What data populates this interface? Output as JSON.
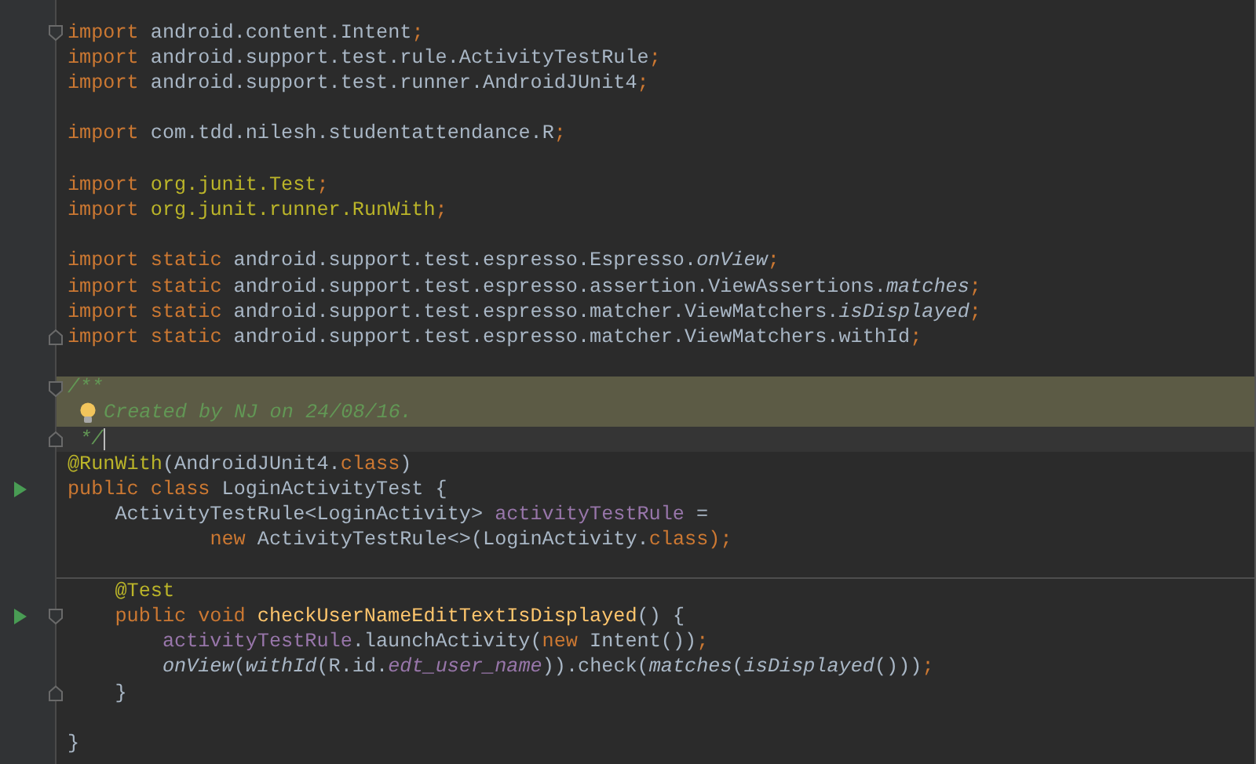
{
  "editor": {
    "lines": [
      {
        "kind": "code",
        "fold_start": true,
        "tokens": [
          {
            "t": "import",
            "kind": "kw"
          },
          {
            "t": " android.content.Intent",
            "kind": "plain"
          },
          {
            "t": ";",
            "kind": "punct"
          }
        ]
      },
      {
        "kind": "code",
        "tokens": [
          {
            "t": "import",
            "kind": "kw"
          },
          {
            "t": " android.support.test.rule.ActivityTestRule",
            "kind": "plain"
          },
          {
            "t": ";",
            "kind": "punct"
          }
        ]
      },
      {
        "kind": "code",
        "tokens": [
          {
            "t": "import",
            "kind": "kw"
          },
          {
            "t": " android.support.test.runner.AndroidJUnit4",
            "kind": "plain"
          },
          {
            "t": ";",
            "kind": "punct"
          }
        ]
      },
      {
        "kind": "blank"
      },
      {
        "kind": "code",
        "tokens": [
          {
            "t": "import",
            "kind": "kw"
          },
          {
            "t": " com.tdd.nilesh.studentattendance.R",
            "kind": "plain"
          },
          {
            "t": ";",
            "kind": "punct"
          }
        ]
      },
      {
        "kind": "blank"
      },
      {
        "kind": "code",
        "tokens": [
          {
            "t": "import",
            "kind": "kw"
          },
          {
            "t": " org.junit.Test",
            "kind": "ann"
          },
          {
            "t": ";",
            "kind": "punct"
          }
        ]
      },
      {
        "kind": "code",
        "tokens": [
          {
            "t": "import",
            "kind": "kw"
          },
          {
            "t": " org.junit.runner.RunWith",
            "kind": "ann"
          },
          {
            "t": ";",
            "kind": "punct"
          }
        ]
      },
      {
        "kind": "blank"
      },
      {
        "kind": "code",
        "tokens": [
          {
            "t": "import static",
            "kind": "kw"
          },
          {
            "t": " android.support.test.espresso.Espresso.",
            "kind": "plain"
          },
          {
            "t": "onView",
            "kind": "italic"
          },
          {
            "t": ";",
            "kind": "punct"
          }
        ]
      },
      {
        "kind": "code",
        "tokens": [
          {
            "t": "import static",
            "kind": "kw"
          },
          {
            "t": " android.support.test.espresso.assertion.ViewAssertions.",
            "kind": "plain"
          },
          {
            "t": "matches",
            "kind": "italic"
          },
          {
            "t": ";",
            "kind": "punct"
          }
        ]
      },
      {
        "kind": "code",
        "tokens": [
          {
            "t": "import static",
            "kind": "kw"
          },
          {
            "t": " android.support.test.espresso.matcher.ViewMatchers.",
            "kind": "plain"
          },
          {
            "t": "isDisplayed",
            "kind": "italic"
          },
          {
            "t": ";",
            "kind": "punct"
          }
        ]
      },
      {
        "kind": "code",
        "fold_end": true,
        "tokens": [
          {
            "t": "import static",
            "kind": "kw"
          },
          {
            "t": " android.support.test.espresso.matcher.ViewMatchers.withId",
            "kind": "plain"
          },
          {
            "t": ";",
            "kind": "punct"
          }
        ]
      },
      {
        "kind": "blank"
      },
      {
        "kind": "code",
        "fold_start": true,
        "highlighted": true,
        "tokens": [
          {
            "t": "/**",
            "kind": "doc"
          }
        ]
      },
      {
        "kind": "code",
        "highlighted": true,
        "tokens": [
          {
            "kind": "bulb"
          },
          {
            "t": "Created by NJ on 24/08/16.",
            "kind": "doc"
          }
        ]
      },
      {
        "kind": "code",
        "fold_end": true,
        "current_line": true,
        "caret": true,
        "tokens": [
          {
            "t": "*/",
            "kind": "doc"
          }
        ]
      },
      {
        "kind": "code",
        "tokens": [
          {
            "t": "@RunWith",
            "kind": "ann"
          },
          {
            "t": "(AndroidJUnit4.",
            "kind": "plain"
          },
          {
            "t": "class",
            "kind": "kw"
          },
          {
            "t": ")",
            "kind": "plain"
          }
        ]
      },
      {
        "kind": "code",
        "run": true,
        "tokens": [
          {
            "t": "public class",
            "kind": "kw"
          },
          {
            "t": " LoginActivityTest {",
            "kind": "plain"
          }
        ],
        "children": [
          {
            "kind": "code",
            "tokens": [
              {
                "t": "ActivityTestRule<LoginActivity> ",
                "kind": "plain"
              },
              {
                "t": "activityTestRule",
                "kind": "field"
              },
              {
                "t": " =",
                "kind": "plain"
              }
            ]
          },
          {
            "kind": "continuation",
            "tokens": [
              {
                "t": "new",
                "kind": "kw"
              },
              {
                "t": " ActivityTestRule<>(LoginActivity.",
                "kind": "plain"
              },
              {
                "t": "class",
                "kind": "kw"
              },
              {
                "t": ");",
                "kind": "punct"
              }
            ]
          },
          {
            "kind": "separator"
          },
          {
            "kind": "code",
            "tokens": [
              {
                "t": "@Test",
                "kind": "ann"
              }
            ]
          },
          {
            "kind": "code",
            "run": true,
            "fold_start": true,
            "tokens": [
              {
                "t": "public void",
                "kind": "kw"
              },
              {
                "t": " checkUserNameEditTextIsDisplayed",
                "kind": "fn"
              },
              {
                "t": "() {",
                "kind": "plain"
              }
            ],
            "children": [
              {
                "kind": "code",
                "tokens": [
                  {
                    "t": "activityTestRule",
                    "kind": "field"
                  },
                  {
                    "t": ".launchActivity(",
                    "kind": "plain"
                  },
                  {
                    "t": "new",
                    "kind": "kw"
                  },
                  {
                    "t": " Intent())",
                    "kind": "plain"
                  },
                  {
                    "t": ";",
                    "kind": "punct"
                  }
                ]
              },
              {
                "kind": "code",
                "tokens": [
                  {
                    "t": "onView",
                    "kind": "italic"
                  },
                  {
                    "t": "(",
                    "kind": "plain"
                  },
                  {
                    "t": "withId",
                    "kind": "italic"
                  },
                  {
                    "t": "(R.id.",
                    "kind": "plain"
                  },
                  {
                    "t": "edt_user_name",
                    "kind": "ifield"
                  },
                  {
                    "t": ")).check(",
                    "kind": "plain"
                  },
                  {
                    "t": "matches",
                    "kind": "italic"
                  },
                  {
                    "t": "(",
                    "kind": "plain"
                  },
                  {
                    "t": "isDisplayed",
                    "kind": "italic"
                  },
                  {
                    "t": "()))",
                    "kind": "plain"
                  },
                  {
                    "t": ";",
                    "kind": "punct"
                  }
                ]
              }
            ]
          },
          {
            "kind": "code",
            "fold_end": true,
            "tokens": [
              {
                "t": "}",
                "kind": "plain"
              }
            ]
          }
        ]
      },
      {
        "kind": "blank"
      },
      {
        "kind": "code",
        "tokens": [
          {
            "t": "}",
            "kind": "plain"
          }
        ]
      }
    ]
  }
}
